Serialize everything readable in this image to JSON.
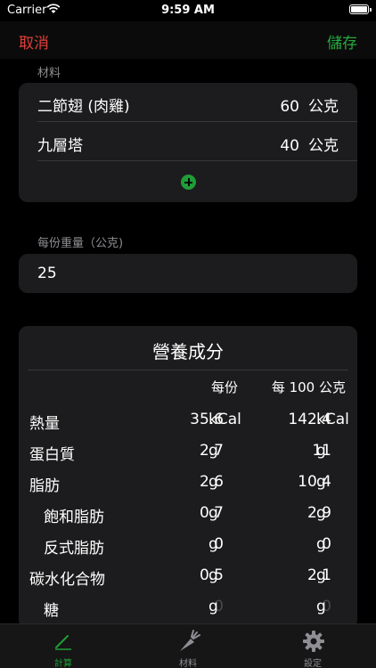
{
  "status_bar": {
    "carrier": "Carrier",
    "time": "9:59 AM"
  },
  "nav": {
    "cancel_label": "取消",
    "save_label": "儲存"
  },
  "ingredients": {
    "section_label": "材料",
    "items": [
      {
        "name": "二節翅 (肉雞)",
        "amount": "60",
        "unit": "公克"
      },
      {
        "name": "九層塔",
        "amount": "40",
        "unit": "公克"
      }
    ]
  },
  "serving": {
    "label": "每份重量（公克)",
    "value": "25"
  },
  "nutrition": {
    "title": "營養成分",
    "col_per_serving": "每份",
    "col_per_100": "每 100 公克",
    "rows": [
      {
        "label": "熱量",
        "per_serving": "35.6",
        "per_100": "142.4",
        "unit": "kCal",
        "indent": false,
        "dim": false
      },
      {
        "label": "蛋白質",
        "per_serving": "2.7",
        "per_100": "11",
        "unit": "g",
        "indent": false,
        "dim": false
      },
      {
        "label": "脂肪",
        "per_serving": "2.6",
        "per_100": "10.4",
        "unit": "g",
        "indent": false,
        "dim": false
      },
      {
        "label": "飽和脂肪",
        "per_serving": "0.7",
        "per_100": "2.9",
        "unit": "g",
        "indent": true,
        "dim": false
      },
      {
        "label": "反式脂肪",
        "per_serving": "0",
        "per_100": "0",
        "unit": "g",
        "indent": true,
        "dim": false
      },
      {
        "label": "碳水化合物",
        "per_serving": "0.5",
        "per_100": "2.1",
        "unit": "g",
        "indent": false,
        "dim": false
      },
      {
        "label": "糖",
        "per_serving": "0",
        "per_100": "0",
        "unit": "g",
        "indent": true,
        "dim": true
      }
    ]
  },
  "tabbar": {
    "tabs": [
      {
        "label": "計算",
        "icon": "pencil-icon",
        "active": true
      },
      {
        "label": "材料",
        "icon": "carrot-icon",
        "active": false
      },
      {
        "label": "設定",
        "icon": "gear-icon",
        "active": false
      }
    ]
  },
  "colors": {
    "accent_green": "#1f9d36",
    "cancel_red": "#e0403a",
    "card_bg": "#1c1c1e"
  }
}
